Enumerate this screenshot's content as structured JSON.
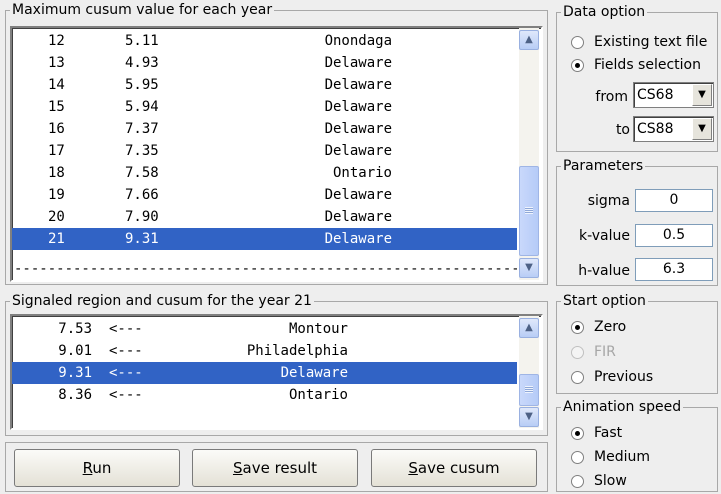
{
  "max_cusum": {
    "title": "Maximum cusum value for each year",
    "rows": [
      {
        "year": "12",
        "value": "5.11",
        "region": "Onondaga"
      },
      {
        "year": "13",
        "value": "4.93",
        "region": "Delaware"
      },
      {
        "year": "14",
        "value": "5.95",
        "region": "Delaware"
      },
      {
        "year": "15",
        "value": "5.94",
        "region": "Delaware"
      },
      {
        "year": "16",
        "value": "7.37",
        "region": "Delaware"
      },
      {
        "year": "17",
        "value": "7.35",
        "region": "Delaware"
      },
      {
        "year": "18",
        "value": "7.58",
        "region": "Ontario"
      },
      {
        "year": "19",
        "value": "7.66",
        "region": "Delaware"
      },
      {
        "year": "20",
        "value": "7.90",
        "region": "Delaware"
      },
      {
        "year": "21",
        "value": "9.31",
        "region": "Delaware"
      }
    ],
    "selected_index": 9,
    "separator": "--------------------------------------------------------------------"
  },
  "signaled": {
    "title": "Signaled region and cusum for the year  21",
    "rows": [
      {
        "value": "7.53",
        "arrow": "<---",
        "region": "Montour"
      },
      {
        "value": "9.01",
        "arrow": "<---",
        "region": "Philadelphia"
      },
      {
        "value": "9.31",
        "arrow": "<---",
        "region": "Delaware"
      },
      {
        "value": "8.36",
        "arrow": "<---",
        "region": "Ontario"
      }
    ],
    "selected_index": 2
  },
  "buttons": {
    "run": {
      "pre": "",
      "key": "R",
      "post": "un"
    },
    "save_result": {
      "pre": "",
      "key": "S",
      "post": "ave result"
    },
    "save_cusum": {
      "pre": "",
      "key": "S",
      "post": "ave cusum"
    }
  },
  "data_option": {
    "title": "Data option",
    "existing": "Existing text file",
    "fields": "Fields selection",
    "selected": "fields",
    "from_label": "from",
    "from_value": "CS68",
    "to_label": "to",
    "to_value": "CS88"
  },
  "parameters": {
    "title": "Parameters",
    "sigma_label": "sigma",
    "sigma_value": "0",
    "k_label": "k-value",
    "k_value": "0.5",
    "h_label": "h-value",
    "h_value": "6.3"
  },
  "start_option": {
    "title": "Start option",
    "zero": "Zero",
    "fir": "FIR",
    "previous": "Previous",
    "selected": "zero"
  },
  "animation": {
    "title": "Animation speed",
    "fast": "Fast",
    "medium": "Medium",
    "slow": "Slow",
    "selected": "fast"
  },
  "icons": {
    "scroll_up": "chevron-up-icon",
    "scroll_down": "chevron-down-icon",
    "combo_arrow": "triangle-down-icon"
  }
}
